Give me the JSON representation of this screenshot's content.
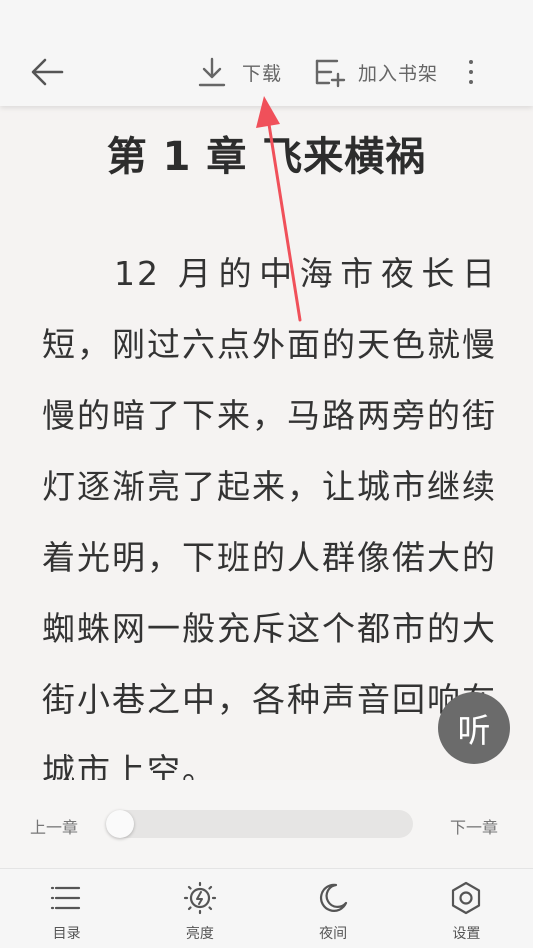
{
  "header": {
    "back_icon": "arrow-left-icon",
    "download_label": "下载",
    "add_shelf_label": "加入书架",
    "more_icon": "more-vertical-icon"
  },
  "chapter": {
    "title": "第 1 章 飞来横祸",
    "paragraph": "12 月的中海市夜长日短，刚过六点外面的天色就慢慢的暗了下来，马路两旁的街灯逐渐亮了起来，让城市继续着光明，下班的人群像偌大的蜘蛛网一般充斥这个都市的大街小巷之中，各种声音回响在城市上空。"
  },
  "listen_button": {
    "label": "听"
  },
  "progress": {
    "prev_label": "上一章",
    "next_label": "下一章",
    "value": 0.0
  },
  "bottom_nav": {
    "items": [
      {
        "label": "目录",
        "icon": "list-icon"
      },
      {
        "label": "亮度",
        "icon": "brightness-icon"
      },
      {
        "label": "夜间",
        "icon": "moon-icon"
      },
      {
        "label": "设置",
        "icon": "settings-icon"
      }
    ]
  },
  "colors": {
    "background": "#f5f3f2",
    "annotation_arrow": "#f0505a",
    "listen_button": "#6b6b6b"
  }
}
